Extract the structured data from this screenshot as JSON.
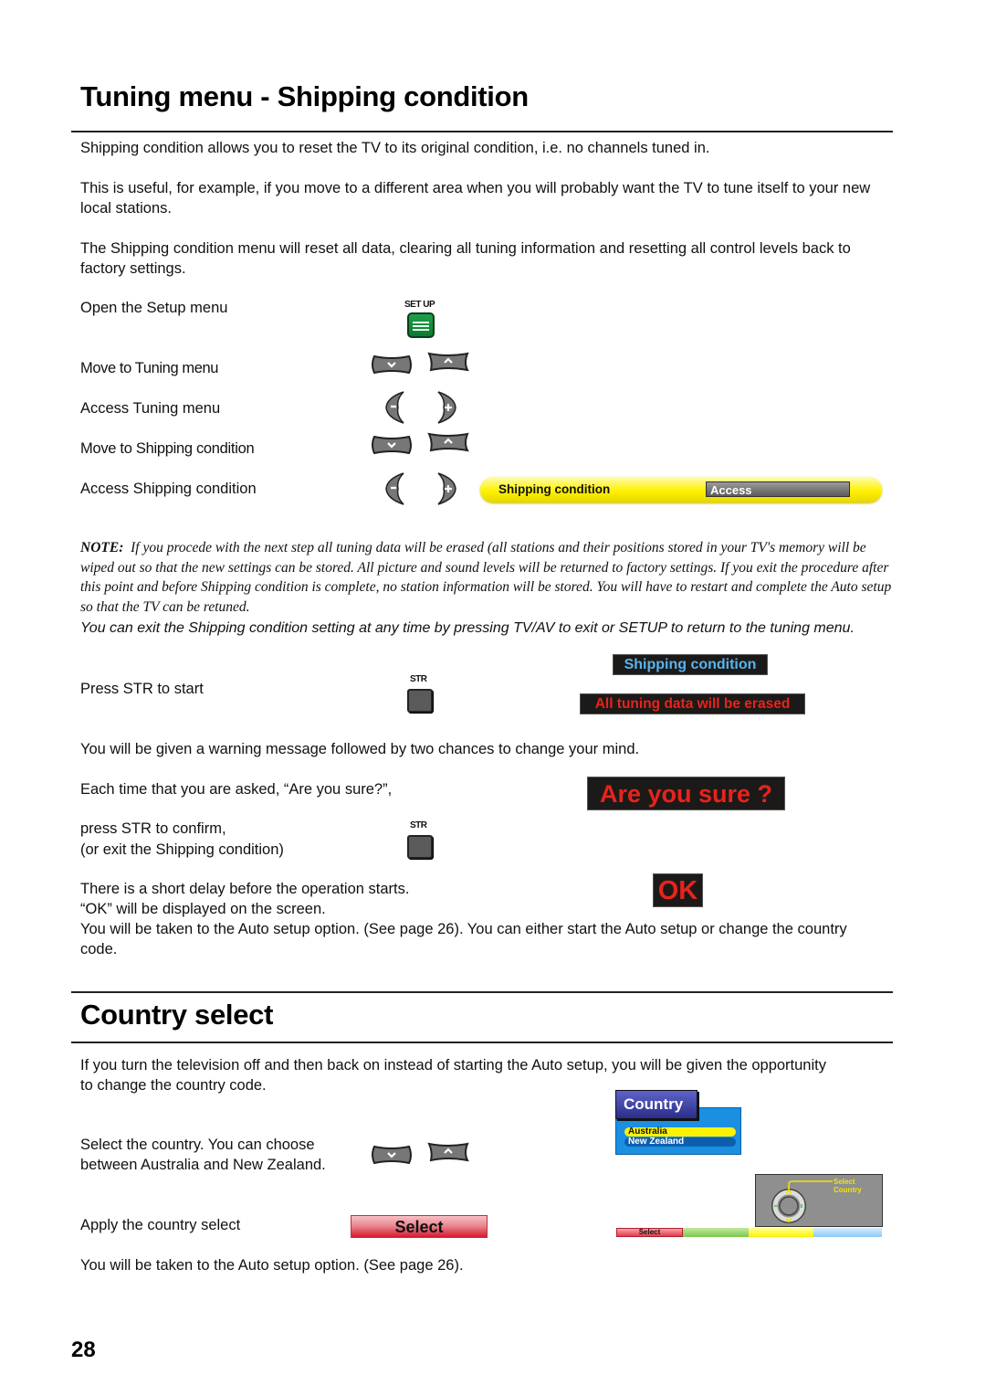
{
  "section1": {
    "title": "Tuning menu - Shipping condition",
    "intro": [
      "Shipping condition allows you to reset the TV to its original condition, i.e. no channels tuned in.",
      "This is useful, for example, if you move to a different area when you will probably want the TV to tune itself to your new local stations.",
      "The Shipping condition menu will reset all data, clearing all tuning information and resetting all control levels back to factory settings."
    ],
    "steps": [
      {
        "text": "Open the Setup menu",
        "buttons": [
          "setup"
        ]
      },
      {
        "text": "Move to Tuning menu",
        "buttons": [
          "down",
          "up"
        ]
      },
      {
        "text": "Access Tuning menu",
        "buttons": [
          "minus",
          "plus"
        ]
      },
      {
        "text": "Move to Shipping condition",
        "buttons": [
          "down",
          "up"
        ]
      },
      {
        "text": "Access Shipping condition",
        "buttons": [
          "minus",
          "plus"
        ]
      }
    ],
    "setup_button_label": "SET UP",
    "osd_menu_row": {
      "label": "Shipping condition",
      "value": "Access"
    },
    "note_label": "NOTE:",
    "note_text": "If you procede with the next step all tuning data will be erased (all stations and their positions  stored in your TV's memory will be wiped out so that the new settings can be stored. All picture and sound levels will be returned to factory settings. If you exit the procedure after this point and before Shipping condition is complete, no station information will be stored. You will have to restart and complete the Auto setup so that the TV can be retuned.",
    "note_exit": "You can exit the Shipping condition setting at any time by pressing TV/AV to exit or SETUP to return to the tuning menu.",
    "press_str": "Press STR to start",
    "str_label": "STR",
    "osd_title": "Shipping condition",
    "osd_warning": "All tuning data will be erased",
    "warning_text": "You will be given a warning message followed by two chances to change your mind.",
    "each_time": "Each time that you are asked, “Are you sure?”,",
    "osd_confirm": "Are you sure ?",
    "press_confirm_1": "press STR to confirm,",
    "press_confirm_2": "(or exit the Shipping condition)",
    "delay_1": "There is a short delay before the operation starts.",
    "delay_2": "“OK” will be displayed on the screen.",
    "osd_ok": "OK",
    "auto_setup": "You will be taken to the Auto setup option. (See page 26). You can either start the Auto setup or change the country code."
  },
  "section2": {
    "title": "Country select",
    "intro": "If you turn the television off and then back on instead of starting the Auto setup, you will be given the opportunity to change the country code.",
    "select_text": "Select the country. You can choose between Australia and New Zealand.",
    "apply_text": "Apply the country select",
    "select_button": "Select",
    "after_text": "You will be taken to the Auto setup option. (See page 26).",
    "osd_country_title": "Country",
    "countries": [
      {
        "name": "Australia",
        "selected": true
      },
      {
        "name": "New Zealand",
        "selected": false
      }
    ],
    "help_label": "Select Country",
    "colorbar_select": "Select"
  },
  "page_number": "28",
  "colors": {
    "osd_red": "#e8231c",
    "osd_blue": "#58b4f0",
    "osd_bg": "#1c1a18",
    "setup_green": "#14903f",
    "menu_yellow": "#fff200",
    "country_blue": "#1b8fe0"
  }
}
